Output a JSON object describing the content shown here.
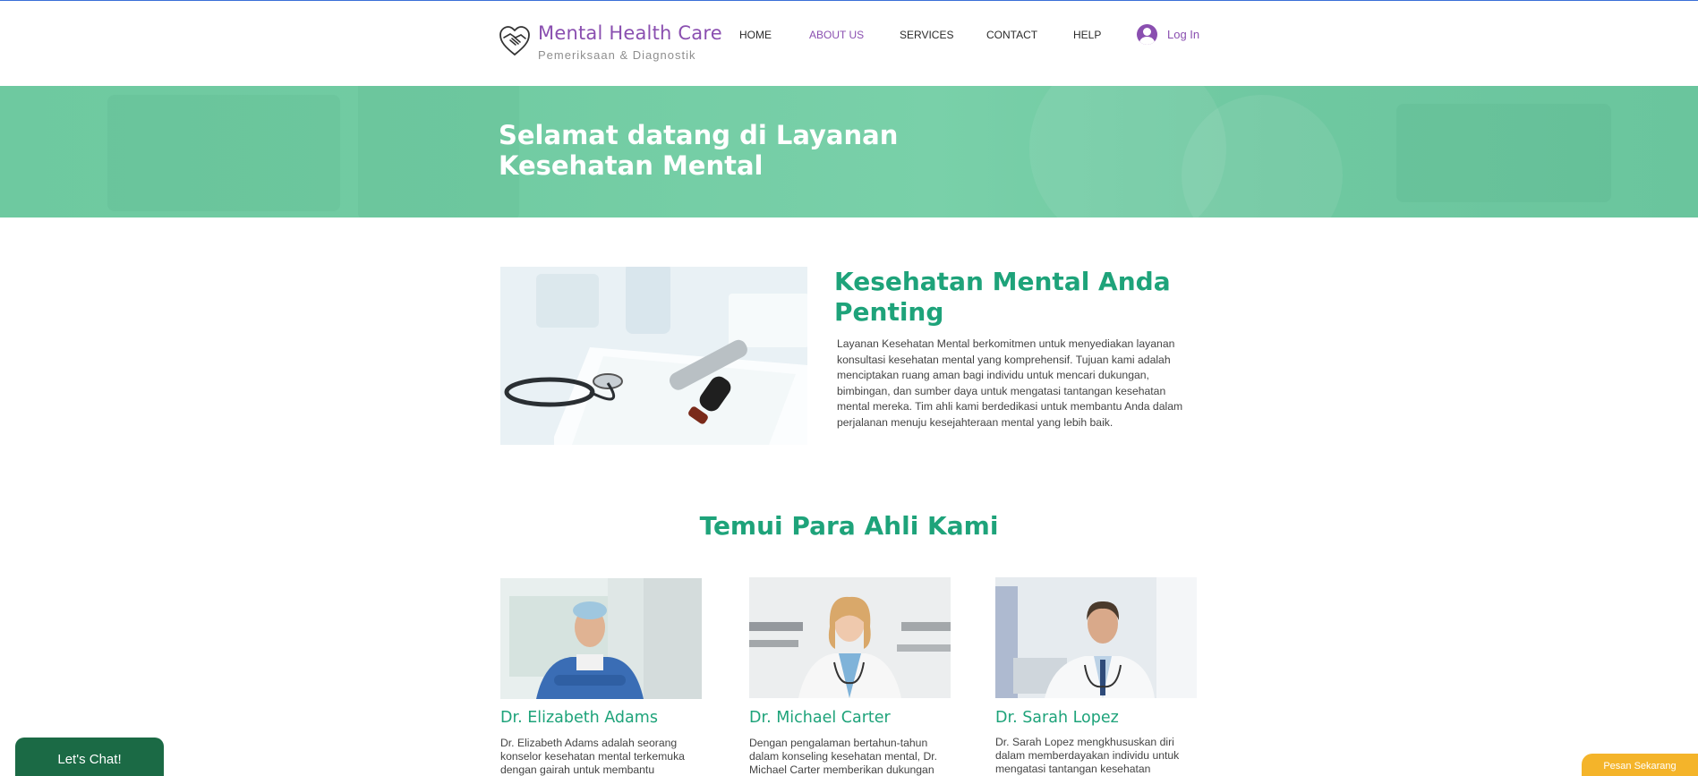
{
  "header": {
    "brand_title": "Mental Health Care",
    "brand_subtitle": "Pemeriksaan & Diagnostik",
    "nav": [
      {
        "label": "HOME"
      },
      {
        "label": "ABOUT US"
      },
      {
        "label": "SERVICES"
      },
      {
        "label": "CONTACT"
      },
      {
        "label": "HELP"
      }
    ],
    "active_nav": "ABOUT US",
    "login_label": "Log In"
  },
  "hero": {
    "title": "Selamat datang di Layanan Kesehatan Mental"
  },
  "about": {
    "title": "Kesehatan Mental Anda Penting",
    "text": "Layanan Kesehatan Mental berkomitmen untuk menyediakan layanan konsultasi kesehatan mental yang komprehensif. Tujuan kami adalah menciptakan ruang aman bagi individu untuk mencari dukungan, bimbingan, dan sumber daya untuk mengatasi tantangan kesehatan mental mereka. Tim ahli kami berdedikasi untuk membantu Anda dalam perjalanan menuju kesejahteraan mental yang lebih baik."
  },
  "experts": {
    "title": "Temui Para Ahli Kami",
    "cards": [
      {
        "name": "Dr. Elizabeth Adams",
        "desc": "Dr. Elizabeth Adams adalah seorang konselor kesehatan mental terkemuka dengan gairah untuk membantu"
      },
      {
        "name": "Dr. Michael Carter",
        "desc": "Dengan pengalaman bertahun-tahun dalam konseling kesehatan mental, Dr. Michael Carter memberikan dukungan"
      },
      {
        "name": "Dr. Sarah Lopez",
        "desc": "Dr. Sarah Lopez mengkhususkan diri dalam memberdayakan individu untuk mengatasi tantangan kesehatan"
      }
    ]
  },
  "widgets": {
    "chat_label": "Let's Chat!",
    "order_label": "Pesan Sekarang"
  },
  "colors": {
    "brand_purple": "#8a4fb0",
    "accent_green": "#1ea37a",
    "hero_green": "#72cca3",
    "chat_green": "#1b6a45",
    "order_yellow": "#f4b42a"
  }
}
